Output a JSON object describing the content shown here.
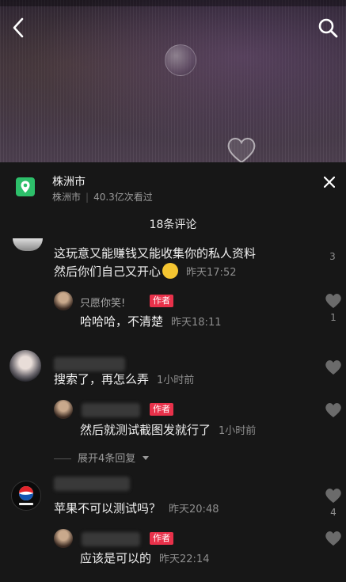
{
  "location": {
    "title": "株洲市",
    "city": "株洲市",
    "views": "40.3亿次看过"
  },
  "comment_count_title": "18条评论",
  "badge_author": "作者",
  "comments": [
    {
      "line1": "这玩意又能赚钱又能收集你的私人资料",
      "line2": "然后你们自己又开心",
      "time": "昨天17:52",
      "like_count": "3",
      "reply": {
        "name": "只愿你笑!",
        "text": "哈哈哈，不清楚",
        "time": "昨天18:11",
        "like_count": "1"
      }
    },
    {
      "text": "搜索了，再怎么弄",
      "time": "1小时前",
      "reply": {
        "text": "然后就测试截图发就行了",
        "time": "1小时前"
      },
      "expand_label": "展开4条回复"
    },
    {
      "text": "苹果不可以测试吗？",
      "time": "昨天20:48",
      "like_count": "4",
      "reply": {
        "text": "应该是可以的",
        "time": "昨天22:14"
      }
    }
  ],
  "icons": {
    "back": "chevron-left-icon",
    "search": "search-icon",
    "close": "close-icon",
    "location": "map-pin-icon",
    "like": "heart-icon",
    "expand": "caret-down-icon"
  },
  "colors": {
    "sheet_bg": "#171717",
    "author_badge": "#e8314a",
    "location_icon": "#2dbf6a"
  }
}
